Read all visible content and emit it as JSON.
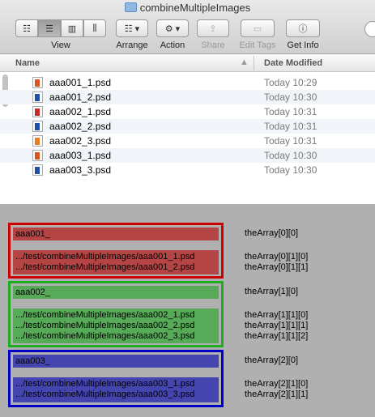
{
  "window": {
    "title": "combineMultipleImages"
  },
  "toolbar": {
    "view_label": "View",
    "arrange_label": "Arrange",
    "action_label": "Action",
    "share_label": "Share",
    "edit_tags_label": "Edit Tags",
    "get_info_label": "Get Info"
  },
  "columns": {
    "name": "Name",
    "date_modified": "Date Modified"
  },
  "files": [
    {
      "name": "aaa001_1.psd",
      "date": "Today 10:29",
      "icon_color": "#d9531e"
    },
    {
      "name": "aaa001_2.psd",
      "date": "Today 10:30",
      "icon_color": "#1f4fa8"
    },
    {
      "name": "aaa002_1.psd",
      "date": "Today 10:31",
      "icon_color": "#c62828"
    },
    {
      "name": "aaa002_2.psd",
      "date": "Today 10:31",
      "icon_color": "#1f4fa8"
    },
    {
      "name": "aaa002_3.psd",
      "date": "Today 10:31",
      "icon_color": "#e67e22"
    },
    {
      "name": "aaa003_1.psd",
      "date": "Today 10:30",
      "icon_color": "#d9531e"
    },
    {
      "name": "aaa003_3.psd",
      "date": "Today 10:30",
      "icon_color": "#1f4fa8"
    }
  ],
  "groups": [
    {
      "key": "aaa001_",
      "key_ref": "theArray[0][0]",
      "paths": [
        ".../test/combineMultipleImages/aaa001_1.psd",
        ".../test/combineMultipleImages/aaa001_2.psd"
      ],
      "path_refs": [
        "theArray[0][1][0]",
        "theArray[0][1][1]"
      ],
      "border_color": "#cc0000",
      "fill_color": "#b54545"
    },
    {
      "key": "aaa002_",
      "key_ref": "theArray[1][0]",
      "paths": [
        ".../test/combineMultipleImages/aaa002_1.psd",
        ".../test/combineMultipleImages/aaa002_2.psd",
        ".../test/combineMultipleImages/aaa002_3.psd"
      ],
      "path_refs": [
        "theArray[1][1][0]",
        "theArray[1][1][1]",
        "theArray[1][1][2]"
      ],
      "border_color": "#1fae1f",
      "fill_color": "#57aa57"
    },
    {
      "key": "aaa003_",
      "key_ref": "theArray[2][0]",
      "paths": [
        ".../test/combineMultipleImages/aaa003_1.psd",
        ".../test/combineMultipleImages/aaa003_3.psd"
      ],
      "path_refs": [
        "theArray[2][1][0]",
        "theArray[2][1][1]"
      ],
      "border_color": "#0000c8",
      "fill_color": "#4545b0"
    }
  ]
}
